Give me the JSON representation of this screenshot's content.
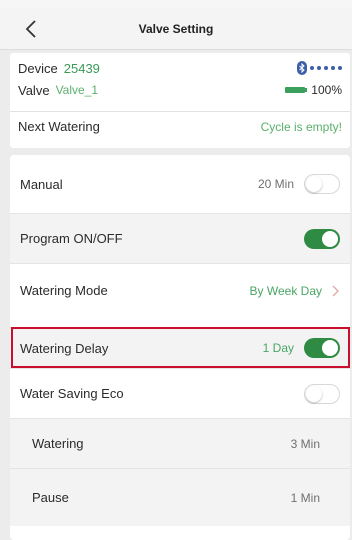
{
  "header": {
    "title": "Valve Setting"
  },
  "device_info": {
    "device_label": "Device",
    "device_value": "25439",
    "valve_label": "Valve",
    "valve_value": "Valve_1",
    "battery_percent": "100%",
    "next_watering_label": "Next Watering",
    "next_watering_value": "Cycle is empty!"
  },
  "settings": {
    "manual": {
      "label": "Manual",
      "value": "20 Min",
      "toggle": false
    },
    "program": {
      "label": "Program ON/OFF",
      "toggle": true
    },
    "watering_mode": {
      "label": "Watering Mode",
      "value": "By Week Day"
    },
    "watering_delay": {
      "label": "Watering Delay",
      "value": "1 Day",
      "toggle": true
    },
    "water_saving": {
      "label": "Water Saving Eco",
      "toggle": false
    },
    "watering": {
      "label": "Watering",
      "value": "3 Min"
    },
    "pause": {
      "label": "Pause",
      "value": "1 Min"
    }
  },
  "colors": {
    "accent_green": "#2f8a43",
    "text_green": "#4aa565",
    "highlight_red": "#c8102e",
    "bluetooth_blue": "#3c5fa8"
  },
  "icons": {
    "back": "chevron-left-icon",
    "bluetooth": "bluetooth-icon",
    "battery": "battery-icon",
    "chevron_right": "chevron-right-icon"
  }
}
